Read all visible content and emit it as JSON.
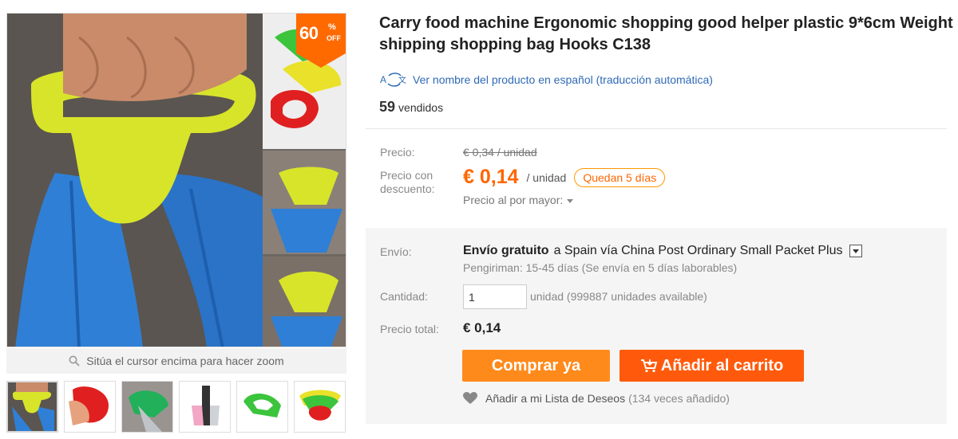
{
  "badge": {
    "percent": "60",
    "percent_sign": "%",
    "off": "OFF"
  },
  "gallery": {
    "zoom_hint": "Sitúa el cursor encima para hacer zoom",
    "thumbnails": [
      "thumb-1",
      "thumb-2",
      "thumb-3",
      "thumb-4",
      "thumb-5",
      "thumb-6"
    ]
  },
  "product": {
    "title_line1": "Carry food machine Ergonomic shopping good helper plastic 9*6cm Weight",
    "title_line2": "shipping shopping bag Hooks C138",
    "translate_link": "Ver nombre del producto en español (traducción automática)",
    "sold_count": "59",
    "sold_label": "vendidos"
  },
  "pricing": {
    "price_label": "Precio:",
    "original_price": "€ 0,34 / unidad",
    "discount_label": "Precio con descuento:",
    "discount_price": "€ 0,14",
    "discount_unit": "/ unidad",
    "remaining": "Quedan 5 días",
    "wholesale": "Precio al por mayor:"
  },
  "shipping": {
    "label": "Envío:",
    "free": "Envío gratuito",
    "destination": "a  Spain vía China Post Ordinary Small Packet Plus",
    "estimate": "Pengiriman: 15-45 días (Se envía en 5 días laborables)"
  },
  "quantity": {
    "label": "Cantidad:",
    "value": "1",
    "unit_text": "unidad (999887 unidades available)"
  },
  "total": {
    "label": "Precio total:",
    "value": "€ 0,14"
  },
  "actions": {
    "buy_now": "Comprar ya",
    "add_to_cart": "Añadir al carrito",
    "wishlist": "Añadir a mi Lista de Deseos",
    "wishlist_count": "(134 veces añadido)"
  },
  "colors": {
    "accent": "#ff6600",
    "buy": "#ff8a1c",
    "cart": "#ff5a0c",
    "link": "#2f6ab6"
  }
}
